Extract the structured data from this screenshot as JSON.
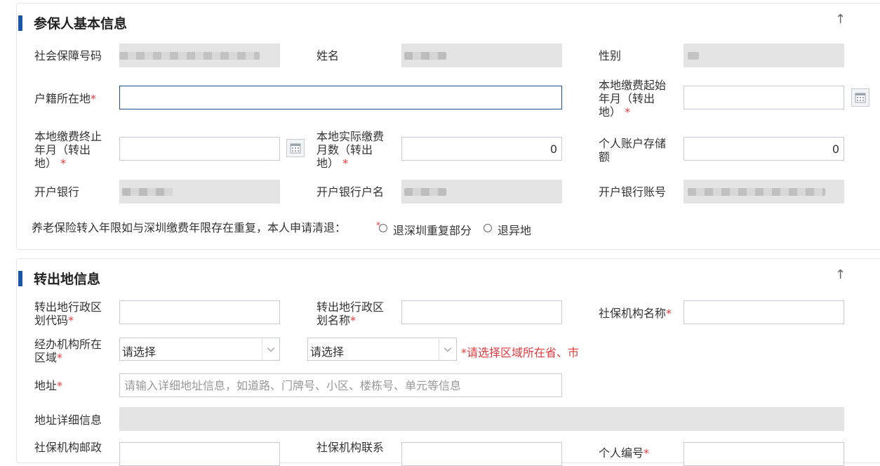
{
  "section1": {
    "title": "参保人基本信息",
    "up_icon": "↑",
    "labels": {
      "ssn": "社会保障号码",
      "name": "姓名",
      "gender": "性别",
      "hukou": "户籍所在地",
      "start_a": "本地缴费起始",
      "start_b": "年月（转出",
      "start_c": "地）",
      "end_a": "本地缴费终止",
      "end_b": "年月（转出",
      "end_c": "地）",
      "months_a": "本地实际缴费",
      "months_b": "月数（转出",
      "months_c": "地）",
      "account_a": "个人账户存储",
      "account_b": "额",
      "bank": "开户银行",
      "bank_holder": "开户银行户名",
      "bank_number": "开户银行账号"
    },
    "values": {
      "hukou": "",
      "start_month": "",
      "end_month": "",
      "months": "0",
      "account_balance": "0"
    },
    "required_mark": "*",
    "dup_question": "养老保险转入年限如与深圳缴费年限存在重复，本人申请清退：",
    "dup_options": [
      "退深圳重复部分",
      "退异地"
    ]
  },
  "section2": {
    "title": "转出地信息",
    "up_icon": "↑",
    "labels": {
      "region_code_a": "转出地行政区",
      "region_code_b": "划代码",
      "region_name_a": "转出地行政区",
      "region_name_b": "划名称",
      "agency_name": "社保机构名称",
      "area_a": "经办机构所在",
      "area_b": "区域",
      "address": "地址",
      "address_detail": "地址详细信息",
      "postcode": "社保机构邮政",
      "contact": "社保机构联系",
      "personal_id": "个人编号"
    },
    "select1": "请选择",
    "select2": "请选择",
    "area_hint": "*请选择区域所在省、市",
    "address_placeholder": "请输入详细地址信息，如道路、门牌号、小区、楼栋号、单元等信息"
  }
}
